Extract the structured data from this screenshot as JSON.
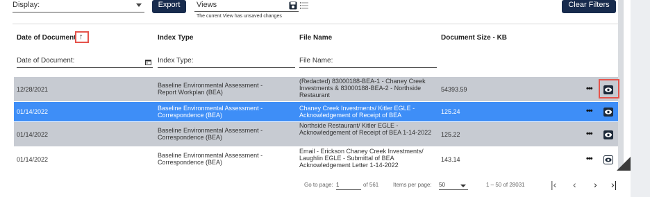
{
  "toolbar": {
    "display_label": "Display:",
    "export_label": "Export",
    "views_label": "Views",
    "unsaved_text": "The current View has unsaved changes",
    "clear_filters_label": "Clear Filters"
  },
  "table": {
    "headers": {
      "date": "Date of Document",
      "index_type": "Index Type",
      "file_name": "File Name",
      "doc_size": "Document Size - KB"
    },
    "sort_arrow": "↑",
    "filters": {
      "date_placeholder": "Date of Document:",
      "index_type_placeholder": "Index Type:",
      "file_name_placeholder": "File Name:"
    },
    "rows": [
      {
        "date": "12/28/2021",
        "index_type": "Baseline Environmental Assessment - Report Workplan (BEA)",
        "file_name": "(Redacted) 83000188-BEA-1 - Chaney Creek Investments & 83000188-BEA-2 - Northside Restaurant",
        "size": "54393.59",
        "more": "•••"
      },
      {
        "date": "01/14/2022",
        "index_type": "Baseline Environmental Assessment - Correspondence (BEA)",
        "file_name": "Chaney Creek Investments/ Kitler EGLE - Acknowledgement of Receipt of BEA",
        "size": "125.24",
        "more": "•••"
      },
      {
        "date": "01/14/2022",
        "index_type": "Baseline Environmental Assessment - Correspondence (BEA)",
        "file_name": "Northside Restaurant/ Kitler EGLE - Acknowledgement of Receipt of BEA 1-14-2022",
        "size": "125.22",
        "more": "•••"
      },
      {
        "date": "01/14/2022",
        "index_type": "Baseline Environmental Assessment - Correspondence (BEA)",
        "file_name": "Email - Erickson Chaney Creek Investments/ Laughlin EGLE - Submittal of BEA Acknowledgement Letter 1-14-2022",
        "size": "143.14",
        "more": "•••"
      }
    ]
  },
  "pagination": {
    "goto_label": "Go to page:",
    "page_value": "1",
    "of_pages": "of 561",
    "items_label": "Items per page:",
    "items_value": "50",
    "range_text": "1 – 50 of 28031",
    "first": "|‹",
    "prev": "‹",
    "next": "›",
    "last": "›|"
  },
  "colors": {
    "accent_dark": "#172b4d",
    "row_gray": "#c7cbd2",
    "row_selected": "#3e8ef7",
    "highlight_box": "#e5534b"
  }
}
